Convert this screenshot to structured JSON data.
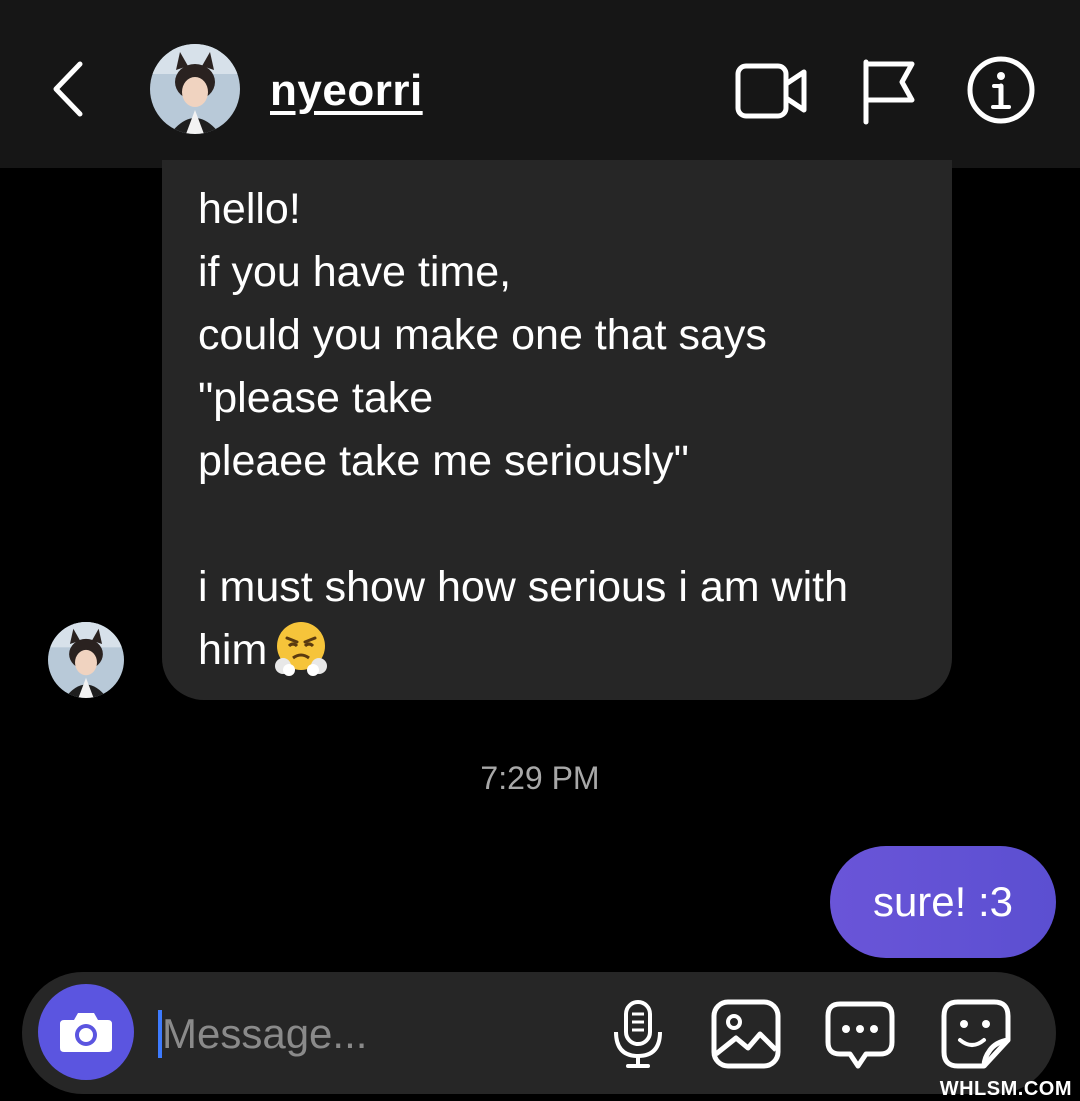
{
  "header": {
    "username": "nyeorri",
    "icons": [
      "back-chevron-icon",
      "avatar",
      "video-call-icon",
      "flag-icon",
      "info-icon"
    ]
  },
  "messages": {
    "incoming_lines": [
      "hello!",
      "if you have time,",
      "could you make one that says",
      "\"please take",
      "pleaee take me seriously\"",
      "",
      "i must show how serious i am with",
      "him"
    ],
    "incoming_emoji": "face-with-steam-from-nose",
    "timestamp": "7:29 PM",
    "outgoing_text": "sure! :3"
  },
  "composer": {
    "placeholder": "Message...",
    "icons": [
      "camera-icon",
      "microphone-icon",
      "gallery-icon",
      "chat-bubble-icon",
      "sticker-icon"
    ]
  },
  "watermark": "WHLSM.COM",
  "colors": {
    "header_bg": "#161616",
    "incoming_bubble": "#262626",
    "outgoing_bubble": "#5b4fd1",
    "camera_button": "#5b55e0"
  }
}
